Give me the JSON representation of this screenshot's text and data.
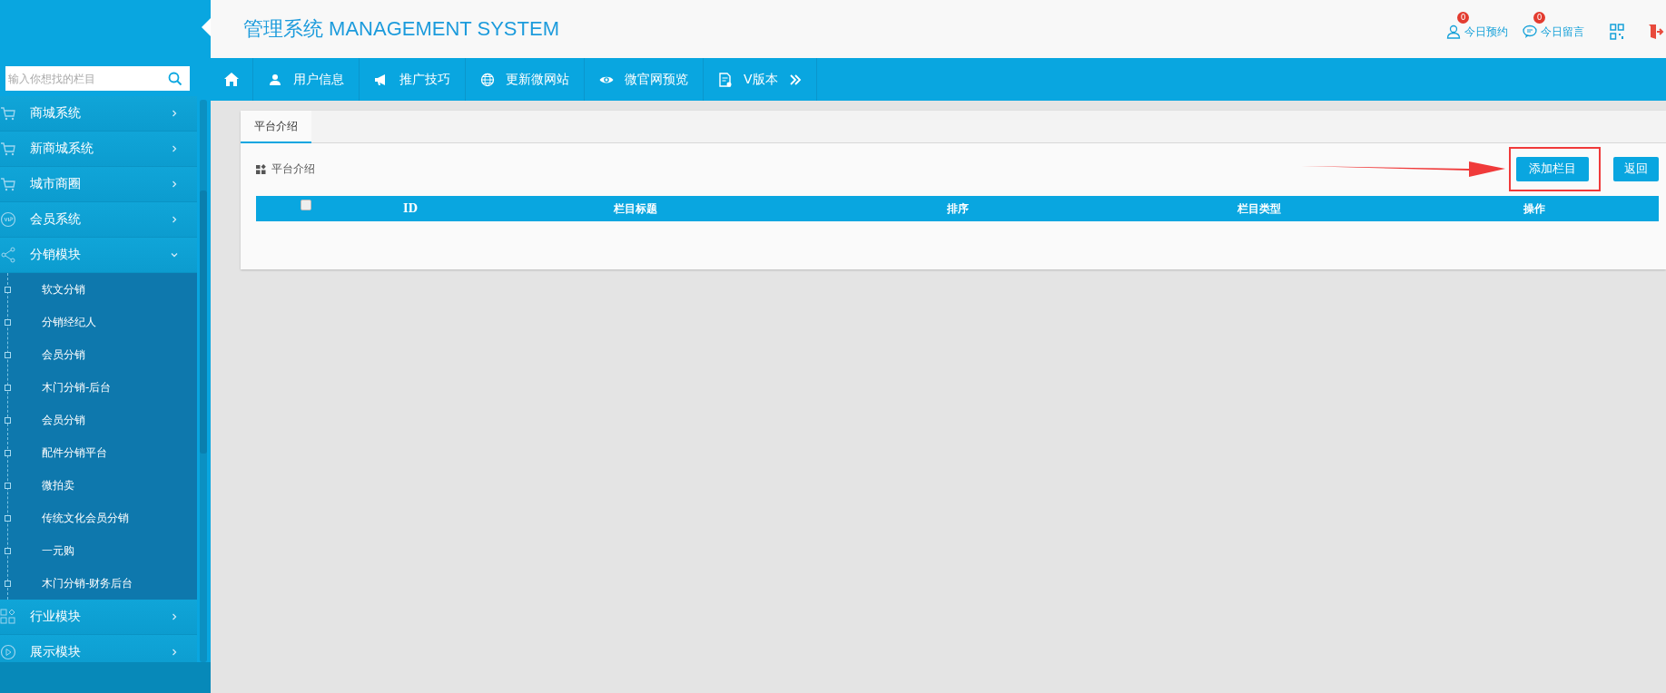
{
  "header": {
    "title": "管理系统 MANAGEMENT SYSTEM",
    "actions": [
      {
        "label": "今日预约",
        "badge": "0"
      },
      {
        "label": "今日留言",
        "badge": "0"
      }
    ]
  },
  "sidebar": {
    "search": {
      "placeholder": "输入你想找的栏目"
    },
    "items": [
      {
        "label": "商城系统",
        "expanded": false
      },
      {
        "label": "新商城系统",
        "expanded": false
      },
      {
        "label": "城市商圈",
        "expanded": false
      },
      {
        "label": "会员系统",
        "expanded": false
      },
      {
        "label": "分销模块",
        "expanded": true,
        "children": [
          {
            "label": "软文分销"
          },
          {
            "label": "分销经纪人"
          },
          {
            "label": "会员分销"
          },
          {
            "label": "木门分销-后台"
          },
          {
            "label": "会员分销"
          },
          {
            "label": "配件分销平台"
          },
          {
            "label": "微拍卖"
          },
          {
            "label": "传统文化会员分销"
          },
          {
            "label": "一元购"
          },
          {
            "label": "木门分销-财务后台"
          }
        ]
      },
      {
        "label": "行业模块",
        "expanded": false
      },
      {
        "label": "展示模块",
        "expanded": false
      }
    ]
  },
  "nav": [
    "用户信息",
    "推广技巧",
    "更新微网站",
    "微官网预览",
    "V版本"
  ],
  "panel": {
    "tabs": [
      {
        "label": "平台介绍",
        "selected": true
      }
    ],
    "heading": "平台介绍",
    "buttons": [
      "添加栏目",
      "返回"
    ],
    "table": {
      "select_all": {
        "checked": false
      },
      "columns": [
        "ID",
        "栏目标题",
        "排序",
        "栏目类型",
        "操作"
      ]
    }
  }
}
